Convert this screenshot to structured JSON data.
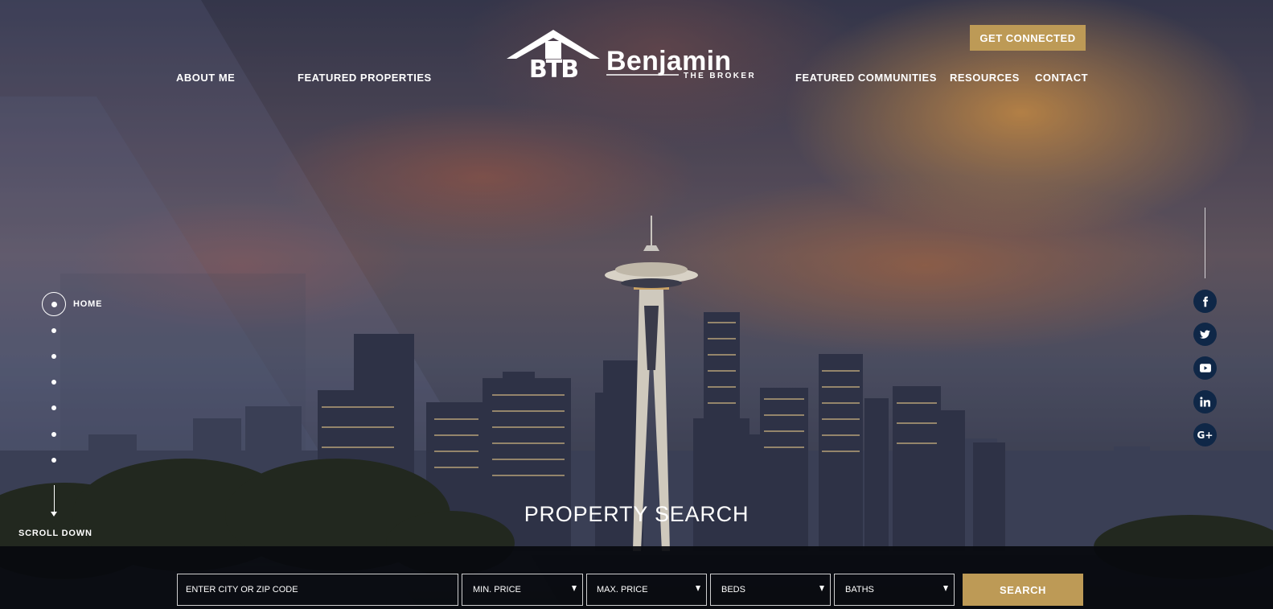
{
  "brand": {
    "monogram": "BTB",
    "name": "Benjamin",
    "tagline": "THE BROKER"
  },
  "nav": {
    "left": [
      "ABOUT ME",
      "FEATURED PROPERTIES"
    ],
    "right": [
      "FEATURED COMMUNITIES",
      "RESOURCES",
      "CONTACT"
    ]
  },
  "cta_label": "GET CONNECTED",
  "side_nav": {
    "active_label": "HOME",
    "scroll_label": "SCROLL DOWN"
  },
  "social": [
    "facebook-icon",
    "twitter-icon",
    "youtube-icon",
    "linkedin-icon",
    "google-plus-icon"
  ],
  "search": {
    "title": "PROPERTY SEARCH",
    "location_placeholder": "ENTER CITY OR ZIP CODE",
    "min_price": "MIN. PRICE",
    "max_price": "MAX. PRICE",
    "beds": "BEDS",
    "baths": "BATHS",
    "button": "SEARCH"
  },
  "colors": {
    "accent_gold": "#bd9a56",
    "social_navy": "#0f2747",
    "search_bar": "#080a0e"
  }
}
